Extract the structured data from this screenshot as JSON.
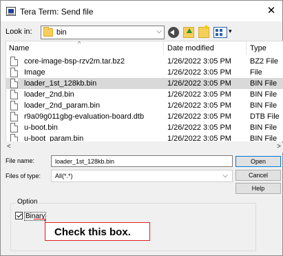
{
  "window": {
    "title": "Tera Term: Send file",
    "close_glyph": "✕"
  },
  "lookin": {
    "label": "Look in:",
    "value": "bin",
    "arrow_glyph": "⌵"
  },
  "toolbar": {
    "icons": [
      "back-icon",
      "up-folder-icon",
      "new-folder-icon",
      "view-menu-icon"
    ],
    "view_arrow_glyph": "▾"
  },
  "filelist": {
    "columns": {
      "name": "Name",
      "date": "Date modified",
      "type": "Type"
    },
    "sort_glyph": "^",
    "rows": [
      {
        "name": "core-image-bsp-rzv2m.tar.bz2",
        "date": "1/26/2022 3:05 PM",
        "type": "BZ2 File",
        "selected": false
      },
      {
        "name": "Image",
        "date": "1/26/2022 3:05 PM",
        "type": "File",
        "selected": false
      },
      {
        "name": "loader_1st_128kb.bin",
        "date": "1/26/2022 3:05 PM",
        "type": "BIN File",
        "selected": true
      },
      {
        "name": "loader_2nd.bin",
        "date": "1/26/2022 3:05 PM",
        "type": "BIN File",
        "selected": false
      },
      {
        "name": "loader_2nd_param.bin",
        "date": "1/26/2022 3:05 PM",
        "type": "BIN File",
        "selected": false
      },
      {
        "name": "r9a09g011gbg-evaluation-board.dtb",
        "date": "1/26/2022 3:05 PM",
        "type": "DTB File",
        "selected": false
      },
      {
        "name": "u-boot.bin",
        "date": "1/26/2022 3:05 PM",
        "type": "BIN File",
        "selected": false
      },
      {
        "name": "u-boot_param.bin",
        "date": "1/26/2022 3:05 PM",
        "type": "BIN File",
        "selected": false
      }
    ]
  },
  "scrollbar": {
    "left_glyph": "<",
    "right_glyph": ">"
  },
  "form": {
    "filename_label": "File name:",
    "filename_value": "loader_1st_128kb.bin",
    "filetype_label": "Files of type:",
    "filetype_value": "All(*.*)",
    "filetype_arrow_glyph": "⌵"
  },
  "buttons": {
    "open": "Open",
    "cancel": "Cancel",
    "help": "Help"
  },
  "option": {
    "group_label": "Option",
    "binary_label": "Binary",
    "binary_checked": true
  },
  "annotation": {
    "text": "Check this box.",
    "color": "#e01e1e"
  }
}
